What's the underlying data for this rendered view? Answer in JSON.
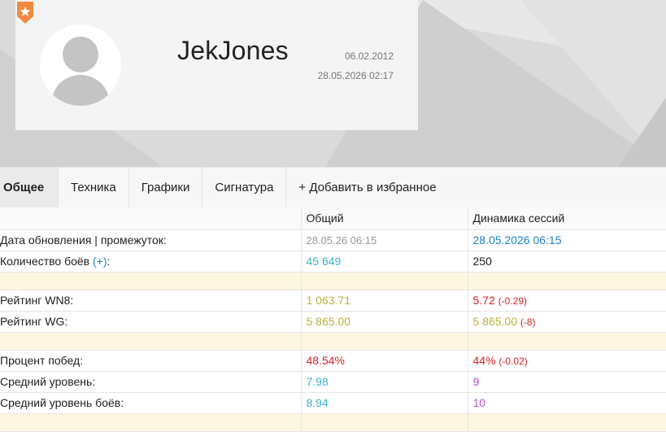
{
  "profile": {
    "username": "JekJones",
    "registered_date": "06.02.2012",
    "last_battle": "28.05.2026 02:17"
  },
  "colors": {
    "badge": "#f08a40",
    "red": "#d2232a",
    "cyan": "#3bb2c8",
    "yellow": "#b8b23a",
    "purple": "#b14fe0",
    "blue": "#1e7fc2"
  },
  "tabs": [
    {
      "label": "Общее"
    },
    {
      "label": "Техника"
    },
    {
      "label": "Графики"
    },
    {
      "label": "Сигнатура"
    },
    {
      "label": "+ Добавить в избранное"
    }
  ],
  "table": {
    "header": {
      "col1": "",
      "col2": "Общий",
      "col3": "Динамика сессий"
    },
    "rows": {
      "update": {
        "label": "Дата обновления | промежуток:",
        "overall": "28.05.26 06:15",
        "session": "28.05.2026 06:15"
      },
      "battles": {
        "label": "Количество боёв",
        "plus": "(+)",
        "colon": ":",
        "overall": "45 649",
        "session": "250"
      },
      "wn8": {
        "label": "Рейтинг WN8:",
        "overall": "1 063.71",
        "session": "5.72",
        "delta": "(-0.29)"
      },
      "wg": {
        "label": "Рейтинг WG:",
        "overall": "5 865.00",
        "session": "5 865.00",
        "delta": "(-8)"
      },
      "winrate": {
        "label": "Процент побед:",
        "overall": "48.54%",
        "session": "44%",
        "delta": "(-0.02)"
      },
      "avg_tier": {
        "label": "Средний уровень:",
        "overall": "7.98",
        "session": "9"
      },
      "avg_battle_tier": {
        "label": "Средний уровень боёв:",
        "overall": "8.94",
        "session": "10"
      }
    }
  }
}
